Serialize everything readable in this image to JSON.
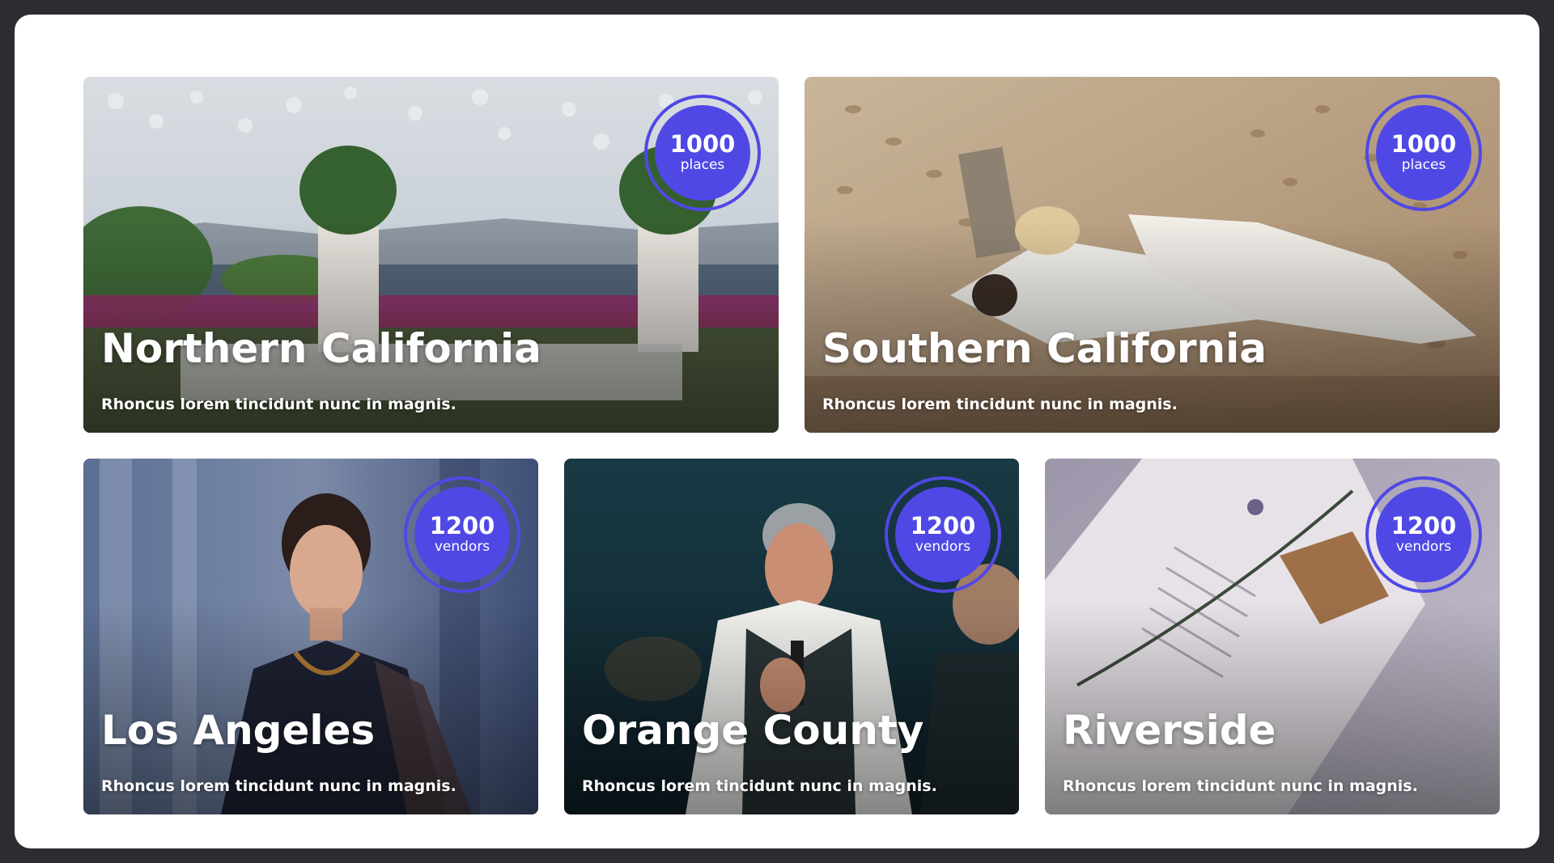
{
  "cards": [
    {
      "title": "Northern California",
      "subtitle": "Rhoncus lorem tincidunt nunc in magnis.",
      "badge": {
        "count": "1000",
        "unit": "places"
      }
    },
    {
      "title": "Southern California",
      "subtitle": "Rhoncus lorem tincidunt nunc in magnis.",
      "badge": {
        "count": "1000",
        "unit": "places"
      }
    },
    {
      "title": "Los Angeles",
      "subtitle": "Rhoncus lorem tincidunt nunc in magnis.",
      "badge": {
        "count": "1200",
        "unit": "vendors"
      }
    },
    {
      "title": "Orange County",
      "subtitle": "Rhoncus lorem tincidunt nunc in magnis.",
      "badge": {
        "count": "1200",
        "unit": "vendors"
      }
    },
    {
      "title": "Riverside",
      "subtitle": "Rhoncus lorem tincidunt nunc in magnis.",
      "badge": {
        "count": "1200",
        "unit": "vendors"
      }
    }
  ],
  "colors": {
    "accent": "#5048e5",
    "frame": "#ffffff",
    "backdrop": "#2d2c32"
  }
}
